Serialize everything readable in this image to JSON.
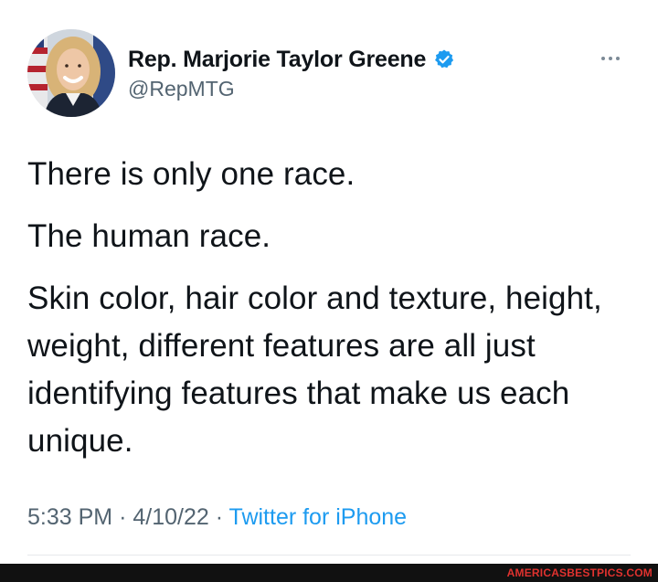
{
  "user": {
    "display_name": "Rep. Marjorie Taylor Greene",
    "handle": "@RepMTG",
    "verified": true
  },
  "icons": {
    "avatar": "profile-photo",
    "verified": "verified-badge-icon",
    "more": "more-options-icon"
  },
  "tweet": {
    "paragraphs": [
      "There is only one race.",
      "The human race.",
      "Skin color, hair color and texture, height, weight, different features are all just identifying features that make us each unique."
    ],
    "time": "5:33 PM",
    "date": "4/10/22",
    "separator": "·",
    "source": "Twitter for iPhone"
  },
  "watermark": "AMERICASBESTPICS.COM",
  "colors": {
    "text": "#0f1419",
    "secondary": "#536471",
    "link": "#1d9bf0",
    "verified": "#1d9bf0",
    "watermark": "#e0322f"
  }
}
